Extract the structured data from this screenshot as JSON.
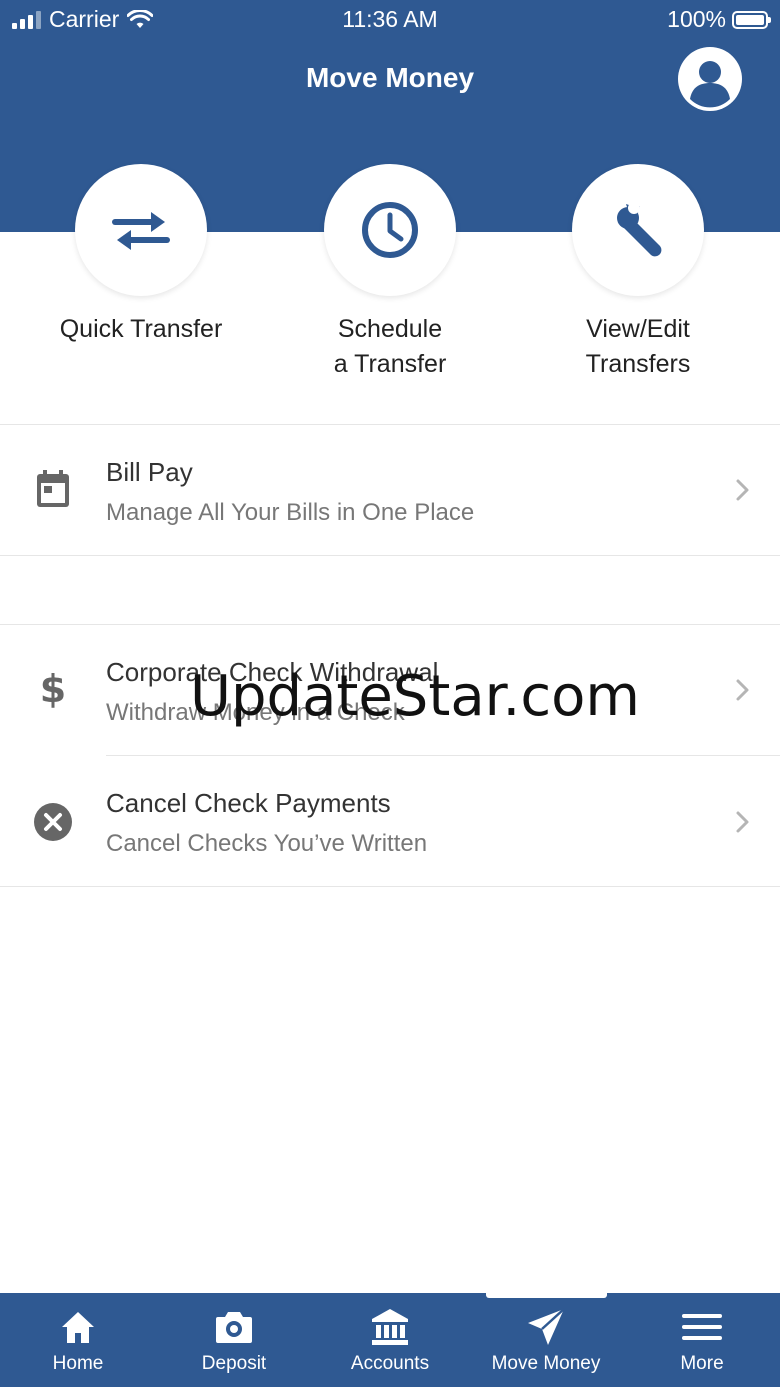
{
  "status_bar": {
    "carrier": "Carrier",
    "time": "11:36 AM",
    "battery": "100%"
  },
  "header": {
    "title": "Move Money",
    "profile_icon": "user-circle-icon"
  },
  "actions": [
    {
      "label": "Quick Transfer",
      "icon": "swap-arrows-icon"
    },
    {
      "label": "Schedule\na Transfer",
      "icon": "clock-icon"
    },
    {
      "label": "View/Edit\nTransfers",
      "icon": "wrench-icon"
    }
  ],
  "list": [
    {
      "title": "Bill Pay",
      "subtitle": "Manage All Your Bills in One Place",
      "icon": "calendar-icon"
    },
    {
      "title": "Corporate Check Withdrawal",
      "subtitle": "Withdraw Money in a Check",
      "icon": "dollar-icon"
    },
    {
      "title": "Cancel Check Payments",
      "subtitle": "Cancel Checks You’ve Written",
      "icon": "cancel-circle-icon"
    }
  ],
  "watermark": "UpdateStar.com",
  "tabs": [
    {
      "label": "Home",
      "icon": "home-icon"
    },
    {
      "label": "Deposit",
      "icon": "camera-icon"
    },
    {
      "label": "Accounts",
      "icon": "bank-icon"
    },
    {
      "label": "Move Money",
      "icon": "paper-plane-icon",
      "active": true
    },
    {
      "label": "More",
      "icon": "menu-icon"
    }
  ],
  "colors": {
    "brand": "#2f5992",
    "icon_gray": "#666666",
    "chevron": "#b5b5b5"
  }
}
